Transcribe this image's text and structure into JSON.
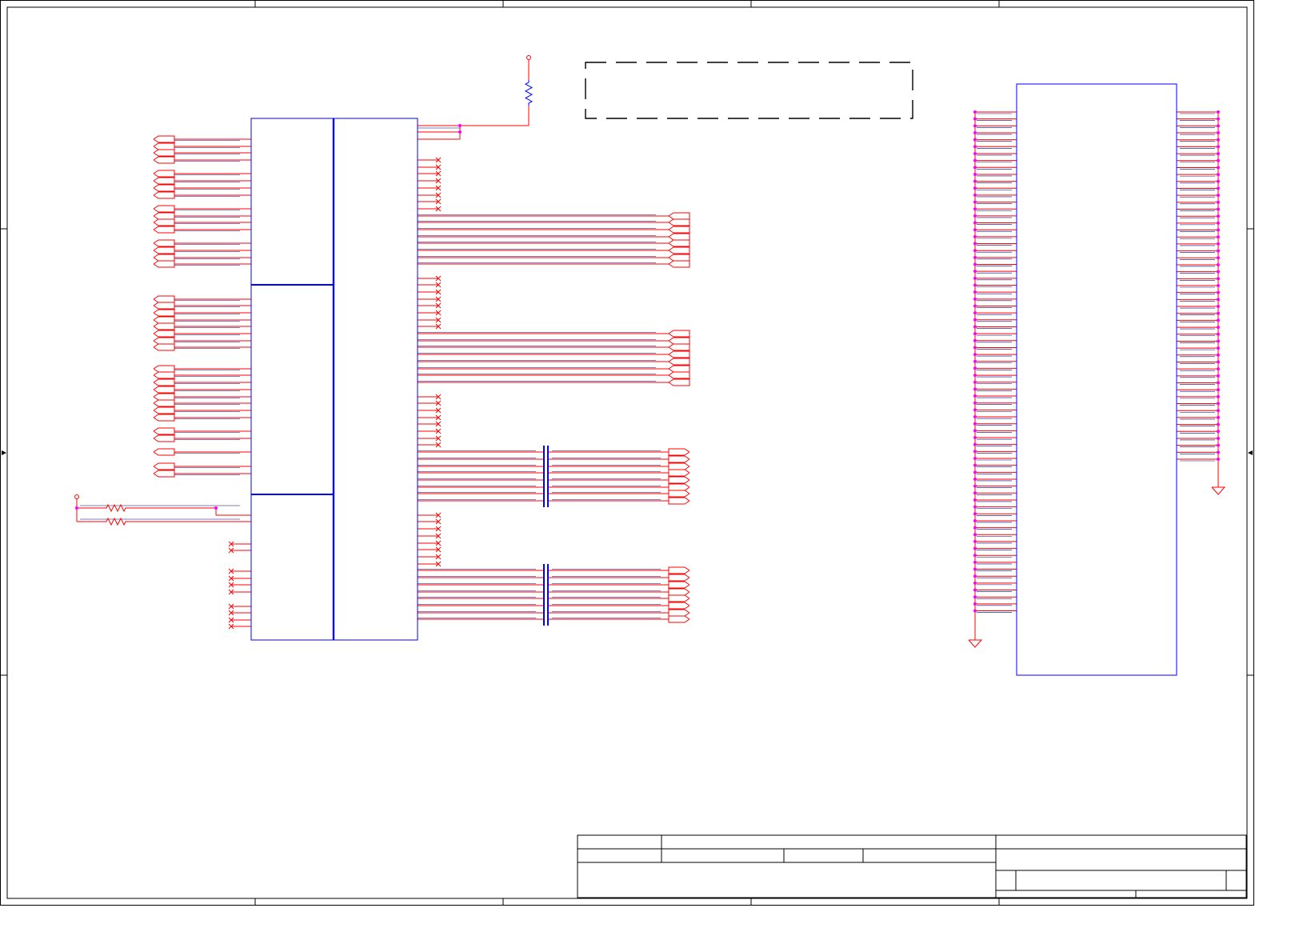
{
  "colors": {
    "wire": "#ff0000",
    "net": "#000080",
    "component": "#0000ff",
    "junction": "#ff00ff",
    "border": "#000000",
    "background": "#ffffff"
  },
  "symbols": [
    "frame-border",
    "ic-block",
    "connector-block",
    "resistor",
    "capacitor",
    "ground-symbol",
    "power-port",
    "net-port",
    "no-connect-mark",
    "dashed-note-box",
    "title-block"
  ]
}
